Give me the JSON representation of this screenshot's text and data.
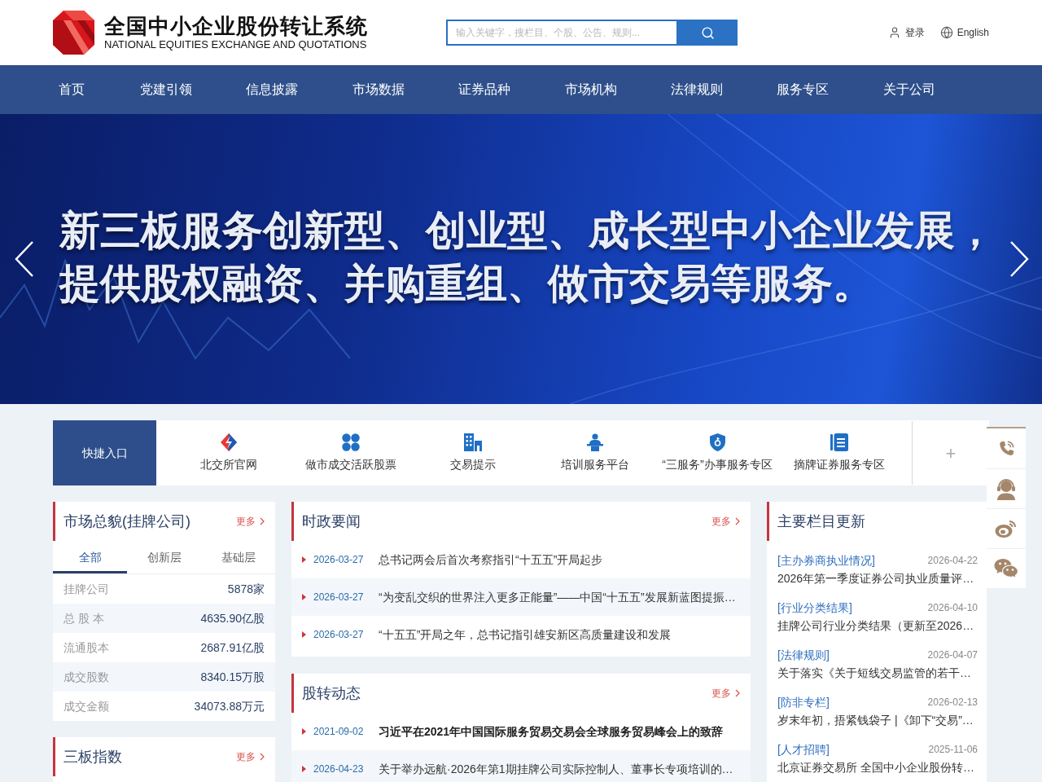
{
  "header": {
    "logo_title": "全国中小企业股份转让系统",
    "logo_subtitle": "NATIONAL EQUITIES EXCHANGE AND QUOTATIONS",
    "search": {
      "placeholder": "输入关键字，搜栏目、个股、公告、规则..."
    },
    "login": "登录",
    "language": "English"
  },
  "nav": [
    "首页",
    "党建引领",
    "信息披露",
    "市场数据",
    "证券品种",
    "市场机构",
    "法律规则",
    "服务专区",
    "关于公司"
  ],
  "banner": {
    "headline_lines": [
      "新三板服务创新型、创业型、成长型中小企业发展，",
      "提供股权融资、并购重组、做市交易等服务。"
    ]
  },
  "quick_entry": {
    "title": "快捷入口",
    "links": [
      "北交所官网",
      "做市成交活跃股票",
      "交易提示",
      "培训服务平台",
      "“三服务”办事服务专区",
      "摘牌证券服务专区"
    ],
    "add": "+"
  },
  "market_overview": {
    "title": "市场总貌(挂牌公司)",
    "more": "更多",
    "tabs": [
      {
        "label": "全部",
        "selected": true
      },
      {
        "label": "创新层",
        "selected": false
      },
      {
        "label": "基础层",
        "selected": false
      }
    ],
    "rows": [
      {
        "label": "挂牌公司",
        "value": "5878家"
      },
      {
        "label": "总 股 本",
        "value": "4635.90亿股"
      },
      {
        "label": "流通股本",
        "value": "2687.91亿股"
      },
      {
        "label": "成交股数",
        "value": "8340.15万股"
      },
      {
        "label": "成交金额",
        "value": "34073.88万元"
      }
    ]
  },
  "index_panel": {
    "title": "三板指数",
    "more": "更多"
  },
  "policy_news": {
    "title": "时政要闻",
    "more": "更多",
    "items": [
      {
        "date": "2026-03-27",
        "title": "总书记两会后首次考察指引“十五五”开局起步",
        "emphasized": false
      },
      {
        "date": "2026-03-27",
        "title": "“为变乱交织的世界注入更多正能量”——中国“十五五”发展新蓝图提振…",
        "emphasized": false
      },
      {
        "date": "2026-03-27",
        "title": "“十五五”开局之年，总书记指引雄安新区高质量建设和发展",
        "emphasized": false
      }
    ]
  },
  "nexq_news": {
    "title": "股转动态",
    "more": "更多",
    "items": [
      {
        "date": "2021-09-02",
        "title": "习近平在2021年中国国际服务贸易交易会全球服务贸易峰会上的致辞",
        "emphasized": true
      },
      {
        "date": "2026-04-23",
        "title": "关于举办远航·2026年第1期挂牌公司实际控制人、董事长专项培训的…",
        "emphasized": false
      }
    ]
  },
  "column_updates": {
    "title": "主要栏目更新",
    "items": [
      {
        "category": "[主办券商执业情况]",
        "date": "2026-04-22",
        "title": "2026年第一季度证券公司执业质量评…"
      },
      {
        "category": "[行业分类结果]",
        "date": "2026-04-10",
        "title": "挂牌公司行业分类结果（更新至2026…"
      },
      {
        "category": "[法律规则]",
        "date": "2026-04-07",
        "title": "关于落实《关于短线交易监管的若干…"
      },
      {
        "category": "[防非专栏]",
        "date": "2026-02-13",
        "title": "岁末年初，捂紧钱袋子 |《卸下“交易”…"
      },
      {
        "category": "[人才招聘]",
        "date": "2025-11-06",
        "title": "北京证券交易所 全国中小企业股份转…"
      }
    ]
  }
}
